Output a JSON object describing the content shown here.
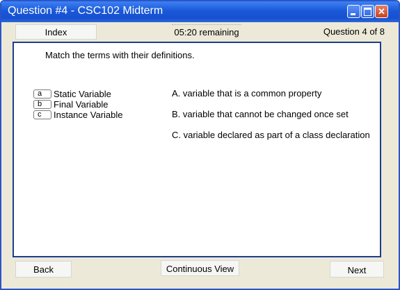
{
  "window": {
    "title": "Question #4 - CSC102 Midterm",
    "controls": {
      "minimize_icon": "minimize-icon",
      "maximize_icon": "maximize-icon",
      "close_icon": "close-icon",
      "close_glyph": "✕"
    },
    "colors": {
      "titlebar": "#1a58d8",
      "border": "#2a55c8",
      "content_border": "#1c3d8f",
      "close": "#c9421f"
    }
  },
  "topbar": {
    "index_label": "Index",
    "timer": "05:20 remaining",
    "question_counter": "Question 4 of 8"
  },
  "question": {
    "instruction": "Match the terms with their definitions.",
    "terms": [
      {
        "answer": "a",
        "label": "Static Variable"
      },
      {
        "answer": "b",
        "label": "Final Variable"
      },
      {
        "answer": "c",
        "label": "Instance Variable"
      }
    ],
    "definitions": [
      "A. variable that is a common property",
      "B. variable that cannot be changed once set",
      "C. variable declared as part of a class declaration"
    ]
  },
  "bottombar": {
    "back_label": "Back",
    "continuous_label": "Continuous View",
    "next_label": "Next"
  }
}
